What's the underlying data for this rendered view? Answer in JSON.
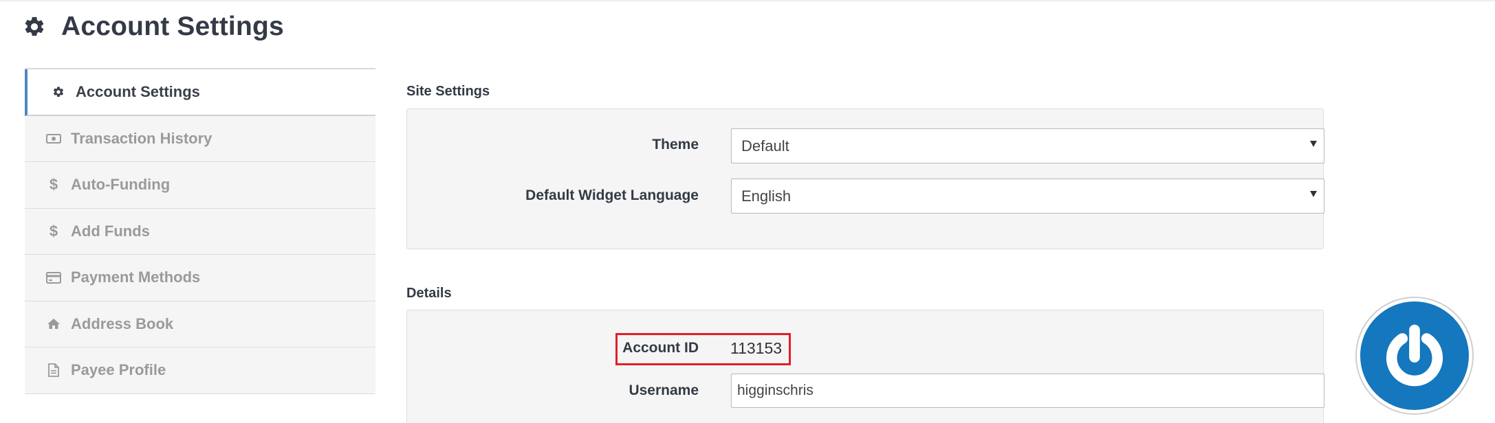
{
  "header": {
    "title": "Account Settings",
    "icon": "gear-icon"
  },
  "sidebar": {
    "items": [
      {
        "label": "Account Settings",
        "icon": "gear-icon",
        "active": true
      },
      {
        "label": "Transaction History",
        "icon": "money-icon",
        "active": false
      },
      {
        "label": "Auto-Funding",
        "icon": "dollar-icon",
        "active": false
      },
      {
        "label": "Add Funds",
        "icon": "dollar-icon",
        "active": false
      },
      {
        "label": "Payment Methods",
        "icon": "credit-card-icon",
        "active": false
      },
      {
        "label": "Address Book",
        "icon": "home-icon",
        "active": false
      },
      {
        "label": "Payee Profile",
        "icon": "document-icon",
        "active": false
      }
    ]
  },
  "site_settings": {
    "title": "Site Settings",
    "theme": {
      "label": "Theme",
      "value": "Default"
    },
    "language": {
      "label": "Default Widget Language",
      "value": "English"
    }
  },
  "details": {
    "title": "Details",
    "account_id": {
      "label": "Account ID",
      "value": "113153"
    },
    "username": {
      "label": "Username",
      "value": "higginschris"
    }
  },
  "widget": {
    "icon": "power-icon"
  },
  "colors": {
    "accent": "#4d87c3",
    "highlight": "#e21e26",
    "widget": "#1577bd"
  }
}
